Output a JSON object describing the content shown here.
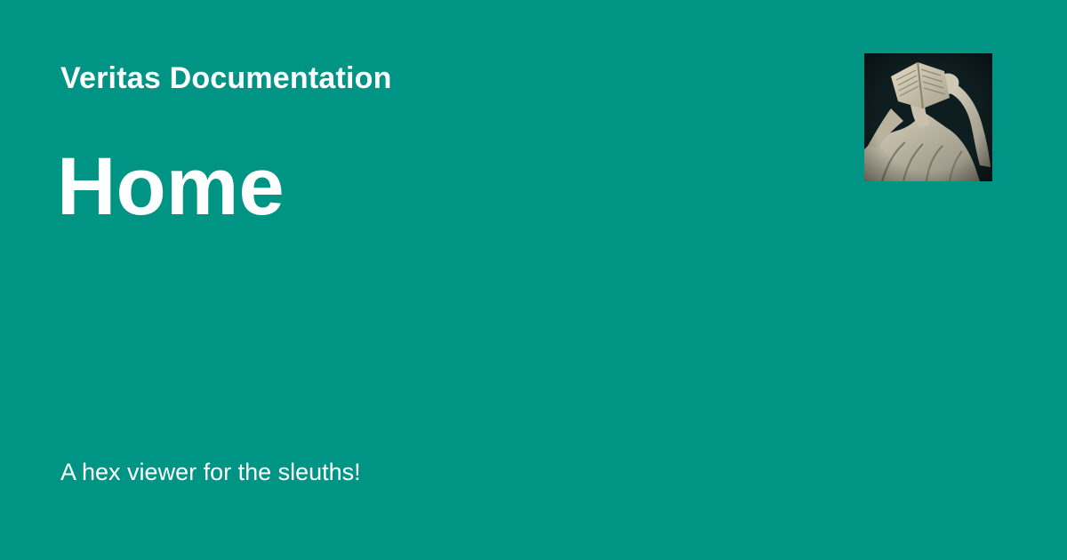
{
  "header": {
    "site_name": "Veritas Documentation"
  },
  "page": {
    "title": "Home",
    "description": "A hex viewer for the sleuths!"
  },
  "logo": {
    "icon": "statue-with-book-icon"
  },
  "colors": {
    "background": "#009485",
    "text": "#ffffff",
    "logo_background": "#0e1d1f"
  }
}
